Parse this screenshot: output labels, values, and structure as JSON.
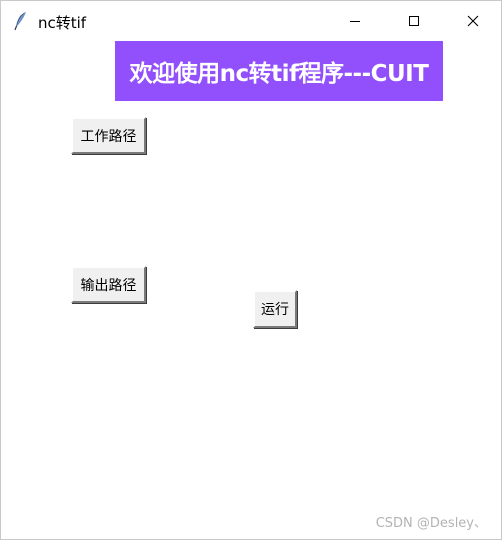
{
  "window": {
    "title": "nc转tif",
    "app_icon": "feather-icon",
    "controls": {
      "minimize_icon": "minimize-icon",
      "maximize_icon": "maximize-icon",
      "close_icon": "close-icon"
    }
  },
  "banner": {
    "text": "欢迎使用nc转tif程序---CUIT",
    "background_color": "#9150fb",
    "text_color": "#ffffff"
  },
  "buttons": {
    "work_path": "工作路径",
    "output_path": "输出路径",
    "run": "运行"
  },
  "watermark": "CSDN @Desley、"
}
